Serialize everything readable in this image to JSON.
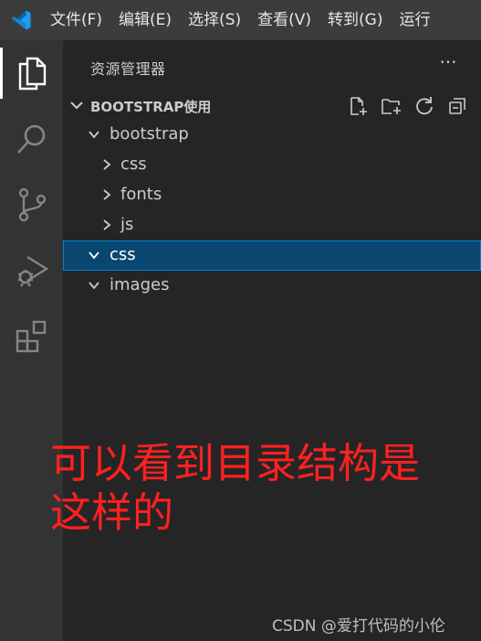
{
  "menubar": {
    "items": [
      "文件(F)",
      "编辑(E)",
      "选择(S)",
      "查看(V)",
      "转到(G)",
      "运行"
    ]
  },
  "activitybar": {
    "items": [
      "explorer-icon",
      "search-icon",
      "source-control-icon",
      "run-debug-icon",
      "extensions-icon"
    ]
  },
  "sidebar": {
    "title": "资源管理器",
    "more": "···",
    "section_title": "BOOTSTRAP使用",
    "section_actions": [
      "new-file-icon",
      "new-folder-icon",
      "refresh-icon",
      "collapse-all-icon"
    ]
  },
  "tree": [
    {
      "label": "bootstrap",
      "expanded": true,
      "selected": false
    },
    {
      "label": "css",
      "expanded": false,
      "selected": false
    },
    {
      "label": "fonts",
      "expanded": false,
      "selected": false
    },
    {
      "label": "js",
      "expanded": false,
      "selected": false
    },
    {
      "label": "css",
      "expanded": true,
      "selected": true
    },
    {
      "label": "images",
      "expanded": true,
      "selected": false
    }
  ],
  "annotation": {
    "line1": "可以看到目录结构是",
    "line2": "这样的",
    "color": "#ff2020"
  },
  "watermark": "CSDN @爱打代码的小伦",
  "colors": {
    "accent": "#007acc",
    "selection": "#094771",
    "selection_border": "#007fd4"
  }
}
